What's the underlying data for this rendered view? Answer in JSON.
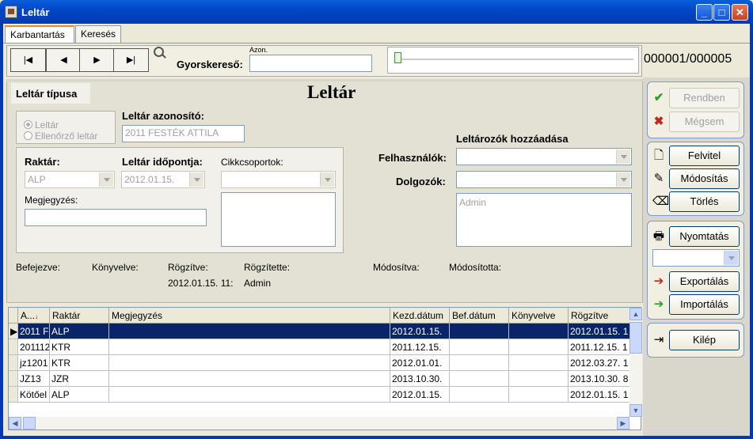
{
  "window": {
    "title": "Leltár"
  },
  "tabs": [
    "Karbantartás",
    "Keresés"
  ],
  "toolbar": {
    "nav": [
      "|◀",
      "◀",
      "▶",
      "▶|"
    ],
    "quicksearch_label": "Gyorskereső:",
    "quicksearch_caption": "Azon.",
    "quicksearch_value": "",
    "record_counter": "000001/000005"
  },
  "form": {
    "type_section": "Leltár típusa",
    "title": "Leltár",
    "radio_options": [
      "Leltár",
      "Ellenőrző leltár"
    ],
    "id_label": "Leltár azonosító:",
    "id_value": "2011 FESTÉK ATTILA",
    "warehouse_label": "Raktár:",
    "warehouse_value": "ALP",
    "time_label": "Leltár időpontja:",
    "time_value": "2012.01.15.",
    "itemgroups_label": "Cikkcsoportok:",
    "note_label": "Megjegyzés:",
    "note_value": "",
    "inventory_takers_title": "Leltározók hozzáadása",
    "users_label": "Felhasználók:",
    "employees_label": "Dolgozók:",
    "takers_list": [
      "Admin"
    ],
    "status": {
      "finished_label": "Befejezve:",
      "booked_label": "Könyvelve:",
      "recorded_label": "Rögzítve:",
      "recorded_value": "2012.01.15. 11:",
      "recorder_label": "Rögzítette:",
      "recorder_value": "Admin",
      "modified_label": "Módosítva:",
      "modifier_label": "Módosította:"
    }
  },
  "grid": {
    "columns": [
      "A...",
      "Raktár",
      "Megjegyzés",
      "Kezd.dátum",
      "Bef.dátum",
      "Könyvelve",
      "Rögzítve"
    ],
    "rows": [
      [
        "2011 F",
        "ALP",
        "",
        "2012.01.15.",
        "",
        "",
        "2012.01.15. 1"
      ],
      [
        "201112",
        "KTR",
        "",
        "2011.12.15.",
        "",
        "",
        "2011.12.15. 1"
      ],
      [
        "jz1201",
        "KTR",
        "",
        "2012.01.01.",
        "",
        "",
        "2012.03.27. 1"
      ],
      [
        "JZ13",
        "JZR",
        "",
        "2013.10.30.",
        "",
        "",
        "2013.10.30. 8"
      ],
      [
        "Kötőel",
        "ALP",
        "",
        "2012.01.15.",
        "",
        "",
        "2012.01.15. 1"
      ]
    ]
  },
  "actions": {
    "ok": "Rendben",
    "cancel": "Mégsem",
    "new": "Felvitel",
    "edit": "Módosítás",
    "delete": "Törlés",
    "print": "Nyomtatás",
    "export": "Exportálás",
    "import": "Importálás",
    "exit": "Kilép"
  },
  "colors": {
    "titlebar": "#0339b0",
    "selected_row": "#0a246a",
    "ok_icon": "#2a9d2a",
    "cancel_icon": "#c0281b"
  }
}
